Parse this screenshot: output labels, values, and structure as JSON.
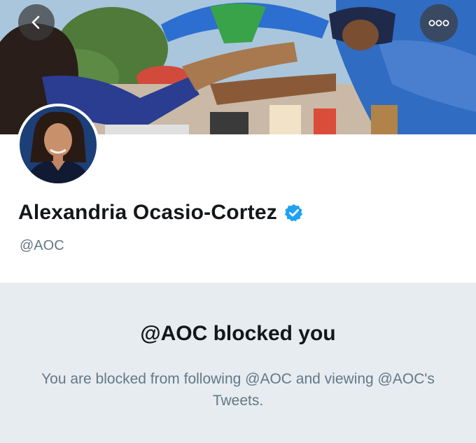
{
  "profile": {
    "display_name": "Alexandria Ocasio-Cortez",
    "handle": "@AOC",
    "verified": true
  },
  "blocked": {
    "title": "@AOC blocked you",
    "message": "You are blocked from following @AOC and viewing @AOC's Tweets."
  },
  "icons": {
    "back": "chevron-left-icon",
    "more": "more-dots-icon",
    "verified": "verified-badge-icon"
  },
  "colors": {
    "verified_blue": "#1da1f2",
    "panel_bg": "#e6ecf0",
    "secondary_text": "#657786",
    "primary_text": "#14171a"
  }
}
